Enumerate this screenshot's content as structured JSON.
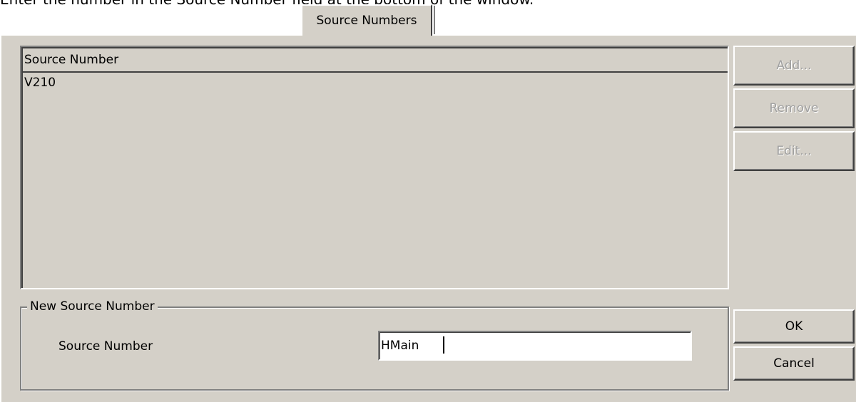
{
  "header": {
    "instruction_text": "Enter the number in the Source Number field at the bottom of the window."
  },
  "tabs": [
    {
      "label": "Source Numbers"
    }
  ],
  "list": {
    "column_header": "Source Number",
    "rows": [
      {
        "source_number": "V210"
      }
    ]
  },
  "side_buttons": {
    "add_label": "Add...",
    "remove_label": "Remove",
    "edit_label": "Edit..."
  },
  "new_source": {
    "group_title": "New Source Number",
    "field_label": "Source Number",
    "field_value": "HMain"
  },
  "dialog_buttons": {
    "ok_label": "OK",
    "cancel_label": "Cancel"
  },
  "colors": {
    "face": "#d4d0c8",
    "disabled_text": "#a0a0a0",
    "shadow": "#808080",
    "highlight": "#ffffff"
  }
}
